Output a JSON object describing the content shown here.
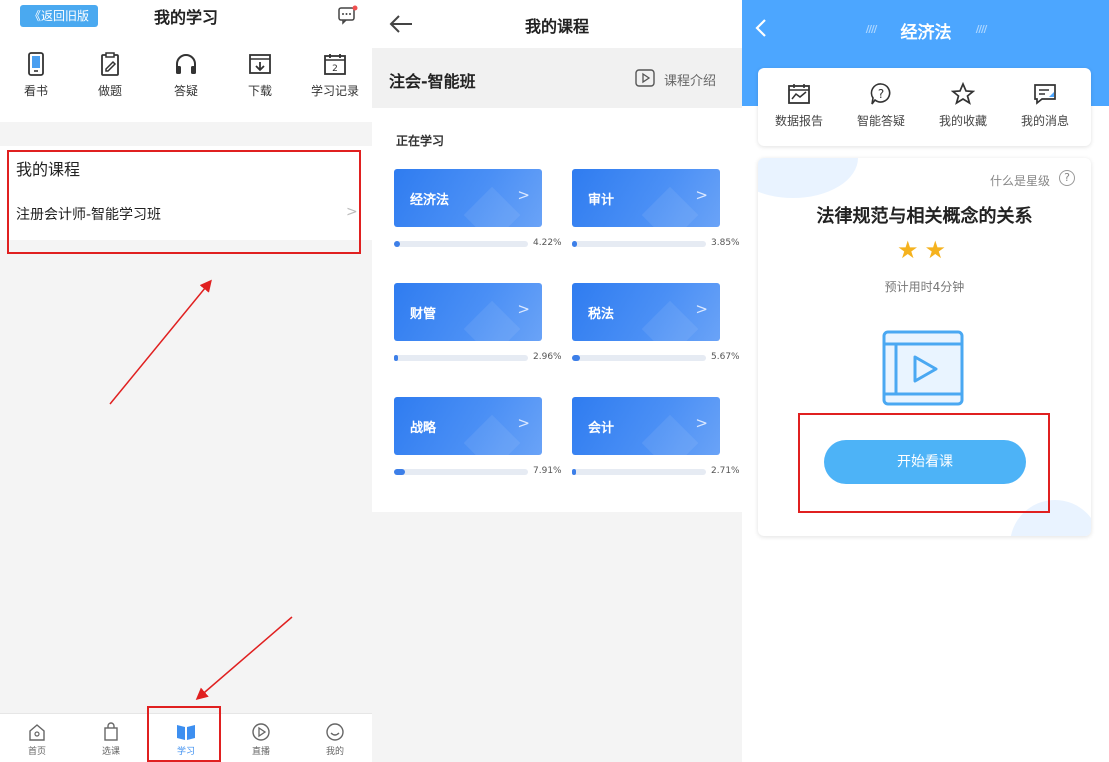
{
  "panel1": {
    "back_old": "《返回旧版",
    "title": "我的学习",
    "tools": [
      {
        "label": "看书",
        "icon": "book-phone-icon"
      },
      {
        "label": "做题",
        "icon": "exercise-icon"
      },
      {
        "label": "答疑",
        "icon": "headphones-icon"
      },
      {
        "label": "下载",
        "icon": "download-icon"
      },
      {
        "label": "学习记录",
        "icon": "calendar-icon"
      }
    ],
    "my_course": {
      "title": "我的课程",
      "item": "注册会计师-智能学习班"
    },
    "tabbar": [
      {
        "label": "首页",
        "icon": "home-icon"
      },
      {
        "label": "选课",
        "icon": "bag-icon"
      },
      {
        "label": "学习",
        "icon": "study-book-icon"
      },
      {
        "label": "直播",
        "icon": "play-circle-icon"
      },
      {
        "label": "我的",
        "icon": "profile-icon"
      }
    ],
    "colors": {
      "accent": "#3d8ff0",
      "highlight": "#e02020"
    }
  },
  "panel2": {
    "title": "我的课程",
    "class_name": "注会-智能班",
    "intro": "课程介绍",
    "studying": "正在学习",
    "courses": [
      {
        "name": "经济法",
        "progress": 4.22,
        "label": "4.22%"
      },
      {
        "name": "审计",
        "progress": 3.85,
        "label": "3.85%"
      },
      {
        "name": "财管",
        "progress": 2.96,
        "label": "2.96%"
      },
      {
        "name": "税法",
        "progress": 5.67,
        "label": "5.67%"
      },
      {
        "name": "战略",
        "progress": 7.91,
        "label": "7.91%"
      },
      {
        "name": "会计",
        "progress": 2.71,
        "label": "2.71%"
      }
    ]
  },
  "panel3": {
    "title": "经济法",
    "menu": [
      {
        "label": "数据报告",
        "icon": "report-icon"
      },
      {
        "label": "智能答疑",
        "icon": "question-bubble-icon"
      },
      {
        "label": "我的收藏",
        "icon": "star-icon"
      },
      {
        "label": "我的消息",
        "icon": "message-icon"
      }
    ],
    "what_star": "什么是星级",
    "topic": "法律规范与相关概念的关系",
    "stars": "★★",
    "star_rating": 2,
    "estimate": "预计用时4分钟",
    "start_button": "开始看课"
  }
}
